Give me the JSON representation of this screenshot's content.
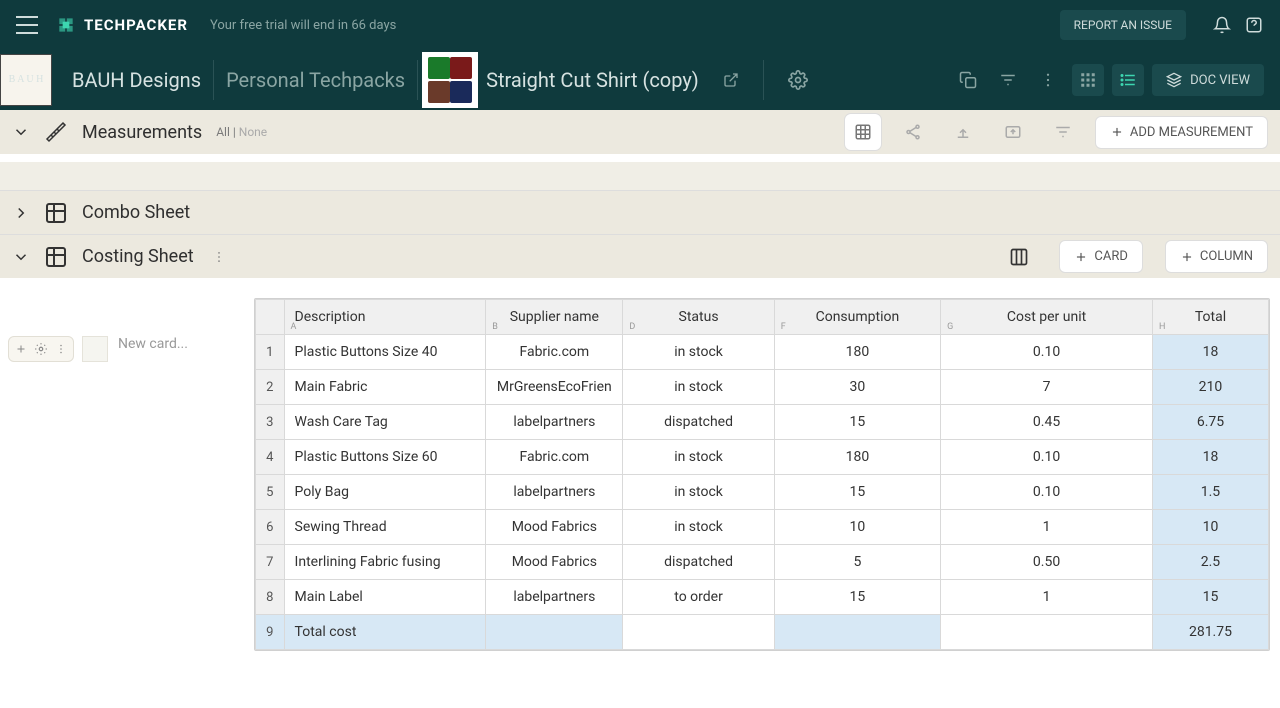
{
  "topbar": {
    "brand": "TECHPACKER",
    "trial": "Your free trial will end in 66 days",
    "report": "REPORT AN ISSUE"
  },
  "breadcrumb": {
    "workspace": "BAUH Designs",
    "collection": "Personal Techpacks",
    "item": "Straight Cut Shirt (copy)",
    "docview": "DOC VIEW"
  },
  "measurements": {
    "title": "Measurements",
    "filter_all": "All",
    "filter_none": "None",
    "add_label": "ADD MEASUREMENT"
  },
  "combo": {
    "title": "Combo Sheet"
  },
  "costing": {
    "title": "Costing Sheet",
    "card_btn": "CARD",
    "column_btn": "COLUMN",
    "new_card_placeholder": "New card...",
    "columns": {
      "a": "Description",
      "b": "Supplier name",
      "d": "Status",
      "f": "Consumption",
      "g": "Cost per unit",
      "h": "Total"
    },
    "col_letters": {
      "a": "A",
      "b": "B",
      "d": "D",
      "f": "F",
      "g": "G",
      "h": "H"
    },
    "rows": [
      {
        "n": "1",
        "desc": "Plastic Buttons Size 40",
        "supp": "Fabric.com",
        "stat": "in stock",
        "cons": "180",
        "cpu": "0.10",
        "tot": "18"
      },
      {
        "n": "2",
        "desc": "Main Fabric",
        "supp": "MrGreensEcoFrien",
        "stat": "in stock",
        "cons": "30",
        "cpu": "7",
        "tot": "210"
      },
      {
        "n": "3",
        "desc": "Wash Care Tag",
        "supp": "labelpartners",
        "stat": "dispatched",
        "cons": "15",
        "cpu": "0.45",
        "tot": "6.75"
      },
      {
        "n": "4",
        "desc": "Plastic Buttons Size 60",
        "supp": "Fabric.com",
        "stat": "in stock",
        "cons": "180",
        "cpu": "0.10",
        "tot": "18"
      },
      {
        "n": "5",
        "desc": "Poly Bag",
        "supp": "labelpartners",
        "stat": "in stock",
        "cons": "15",
        "cpu": "0.10",
        "tot": "1.5"
      },
      {
        "n": "6",
        "desc": "Sewing Thread",
        "supp": "Mood Fabrics",
        "stat": "in stock",
        "cons": "10",
        "cpu": "1",
        "tot": "10"
      },
      {
        "n": "7",
        "desc": "Interlining Fabric fusing",
        "supp": "Mood Fabrics",
        "stat": "dispatched",
        "cons": "5",
        "cpu": "0.50",
        "tot": "2.5"
      },
      {
        "n": "8",
        "desc": "Main Label",
        "supp": "labelpartners",
        "stat": "to order",
        "cons": "15",
        "cpu": "1",
        "tot": "15"
      }
    ],
    "total_row": {
      "n": "9",
      "desc": "Total cost",
      "tot": "281.75"
    }
  }
}
